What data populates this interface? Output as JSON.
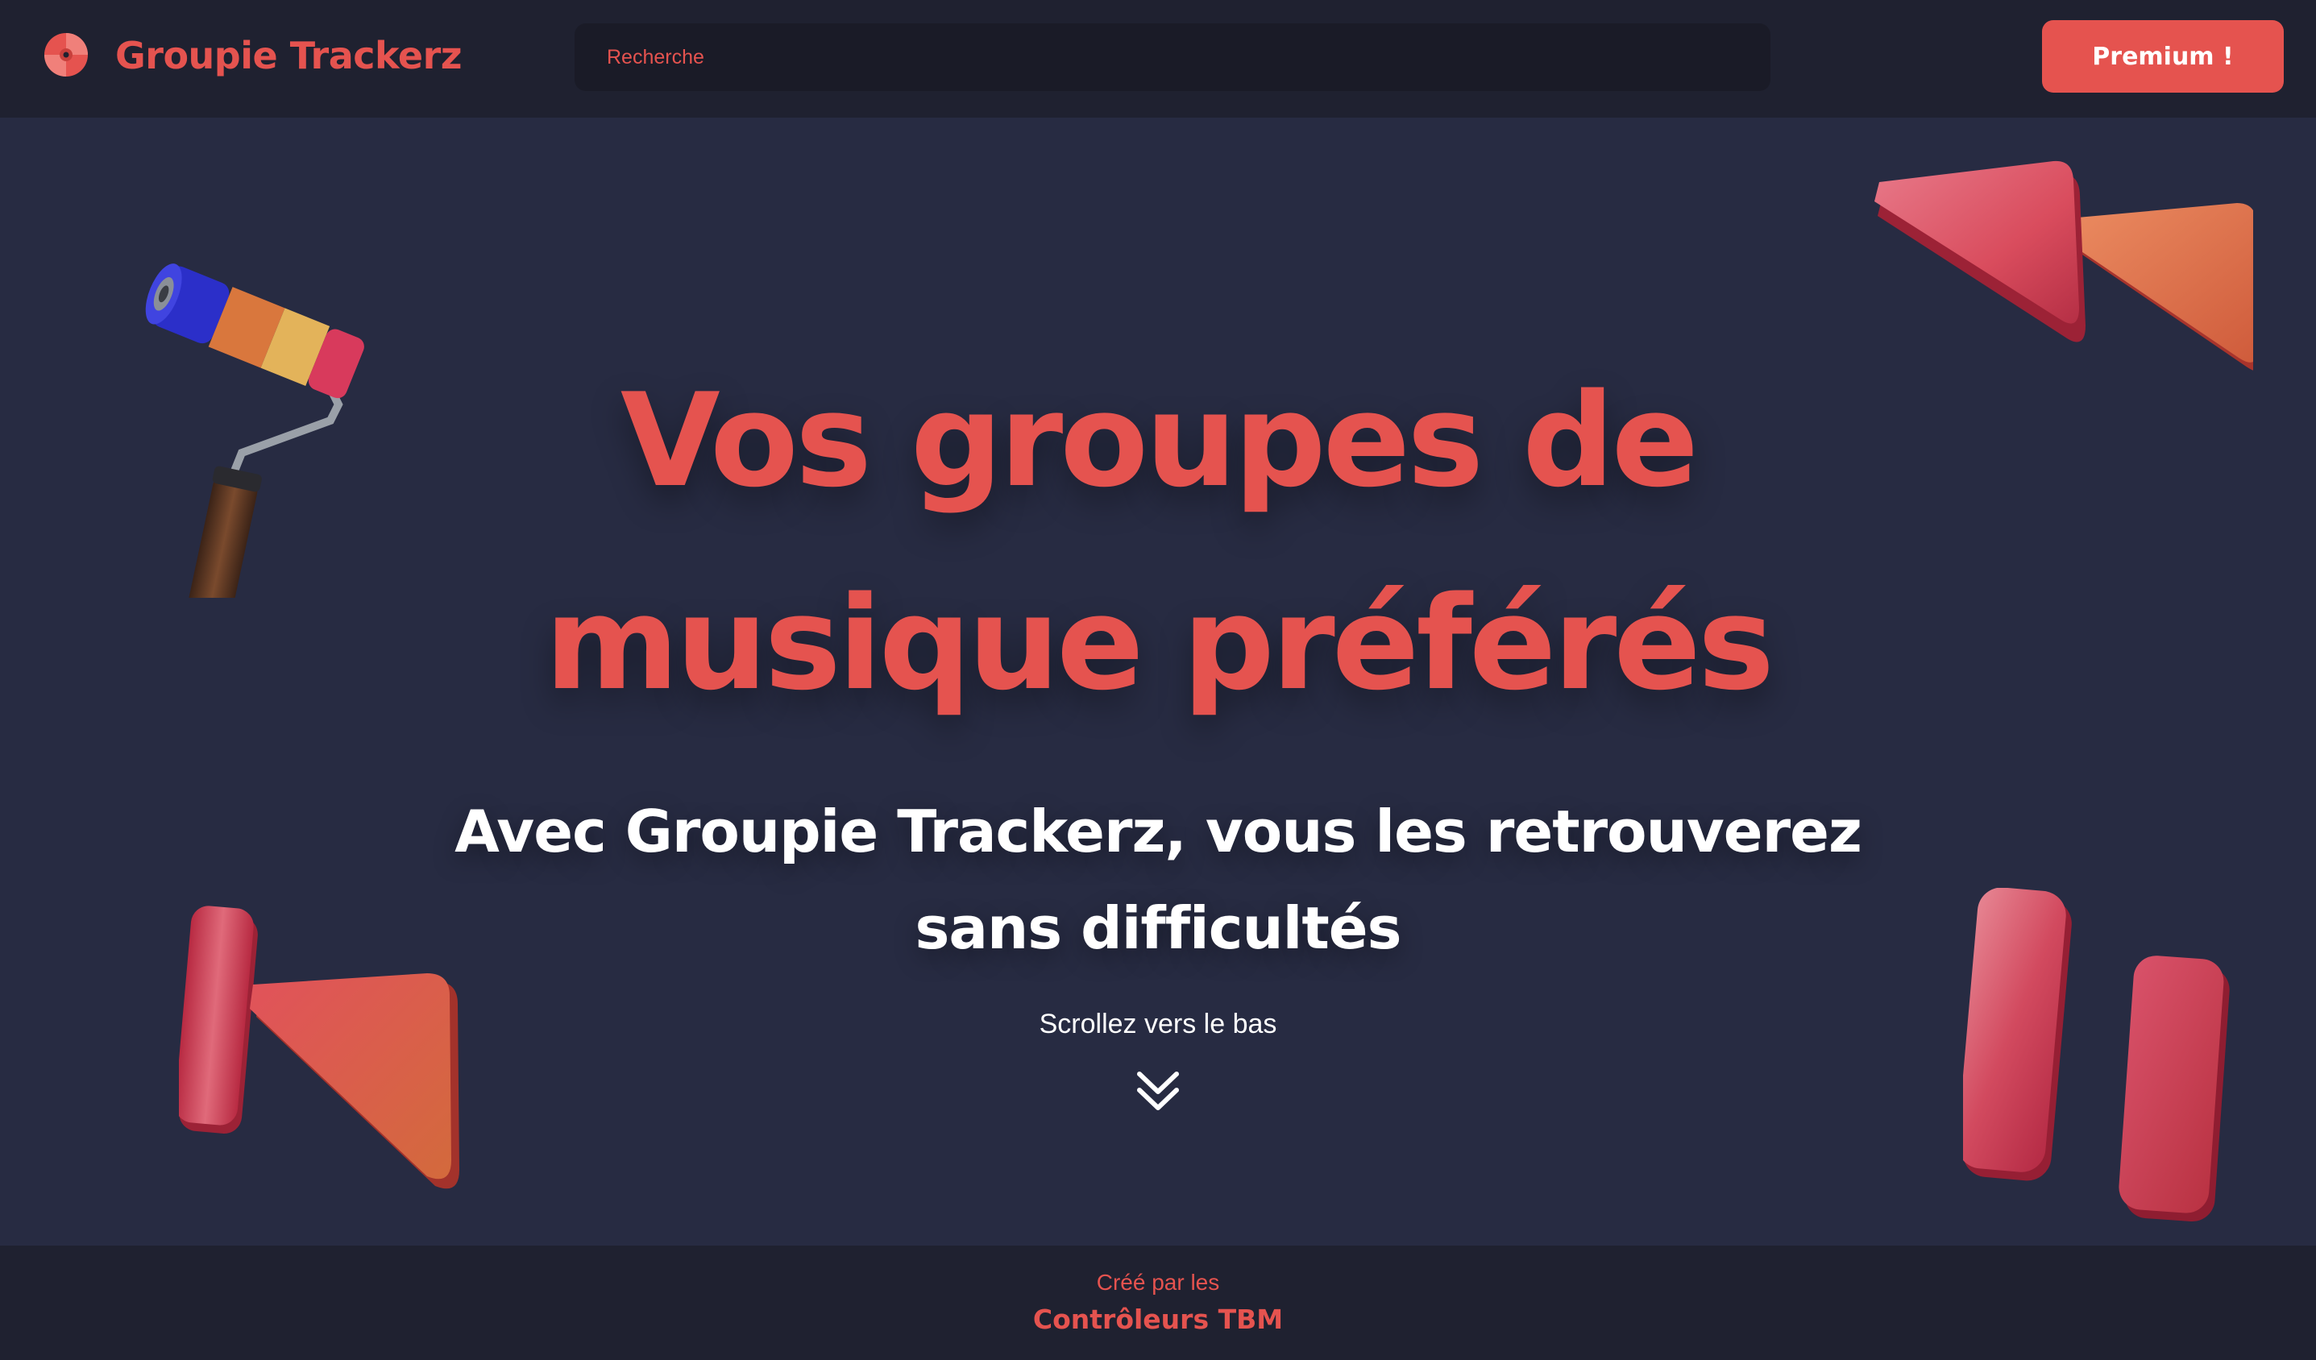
{
  "header": {
    "brand": "Groupie Trackerz",
    "search_placeholder": "Recherche",
    "premium_label": "Premium !"
  },
  "hero": {
    "headline_line1": "Vos groupes de",
    "headline_line2": "musique préférés",
    "subhead_line1": "Avec Groupie Trackerz, vous les retrouverez",
    "subhead_line2": "sans difficultés",
    "scroll_hint": "Scrollez vers le bas"
  },
  "footer": {
    "created_by": "Créé par les",
    "team": "Contrôleurs TBM"
  },
  "icons": {
    "logo": "vinyl-record-icon",
    "scroll": "double-chevron-down-icon",
    "decorations": [
      "paint-roller-icon",
      "rewind-icon",
      "previous-track-icon",
      "pause-icon"
    ]
  },
  "colors": {
    "accent": "#e5534f",
    "background": "#272b42",
    "navbar": "#1f2130",
    "search_bg": "#1a1b27",
    "text_light": "#ffffff"
  }
}
